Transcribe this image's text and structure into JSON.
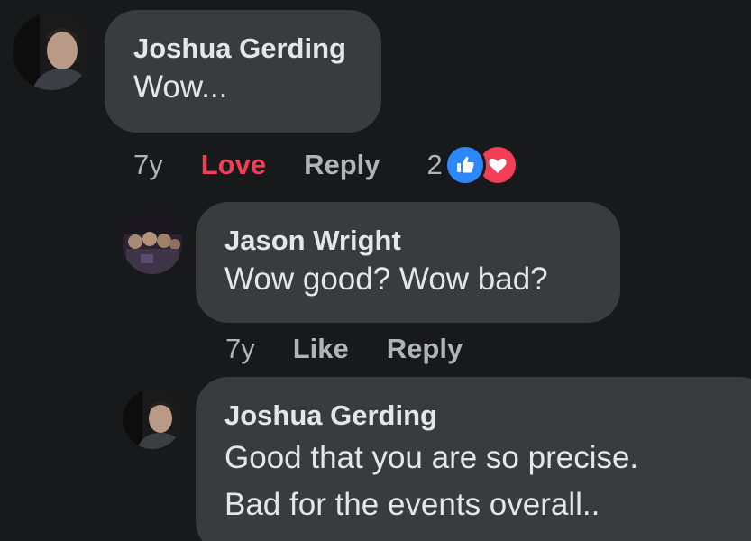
{
  "comments": [
    {
      "author": "Joshua Gerding",
      "text_lines": [
        "Wow..."
      ],
      "time": "7y",
      "reaction_action": "Love",
      "reply_label": "Reply",
      "reaction_count": "2",
      "reaction_icons": [
        "like-icon",
        "love-icon"
      ]
    },
    {
      "author": "Jason Wright",
      "text_lines": [
        "Wow good? Wow bad?"
      ],
      "time": "7y",
      "reaction_action": "Like",
      "reply_label": "Reply"
    },
    {
      "author": "Joshua Gerding",
      "text_lines": [
        "Good that you are so precise.",
        "Bad for the events overall.."
      ]
    }
  ],
  "colors": {
    "background": "#18191a",
    "bubble": "#3a3b3c",
    "text": "#e4e6eb",
    "secondary_text": "#b0b3b8",
    "love": "#f33e58",
    "like": "#2d88ff"
  }
}
